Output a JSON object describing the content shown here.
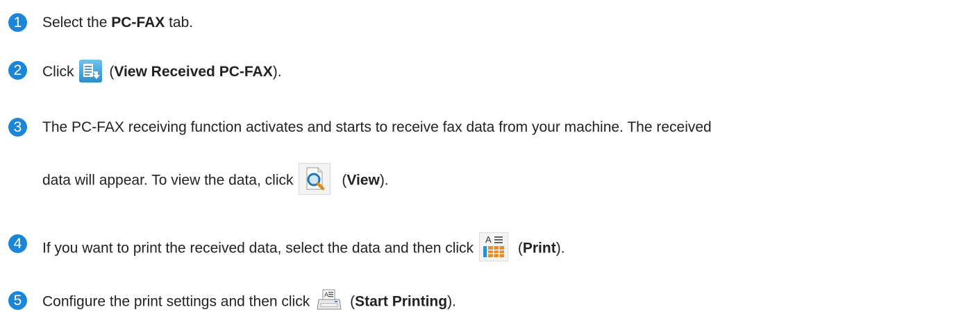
{
  "steps": [
    {
      "number": "1",
      "before": "Select the ",
      "bold": "PC-FAX",
      "after": " tab."
    },
    {
      "number": "2",
      "before": "Click ",
      "icon": "view-received-pcfax-icon",
      "paren_open": "(",
      "bold": "View Received PC-FAX",
      "after": ")."
    },
    {
      "number": "3",
      "line1": "The PC-FAX receiving function activates and starts to receive fax data from your machine. The received",
      "before": "data will appear. To view the data, click ",
      "icon": "view-magnifier-icon",
      "paren_open": "(",
      "bold": "View",
      "after": ")."
    },
    {
      "number": "4",
      "before": "If you want to print the received data, select the data and then click ",
      "icon": "print-icon",
      "paren_open": "(",
      "bold": "Print",
      "after": ")."
    },
    {
      "number": "5",
      "before": "Configure the print settings and then click ",
      "icon": "start-printing-icon",
      "paren_open": "(",
      "bold": "Start Printing",
      "after": ")."
    }
  ],
  "colors": {
    "step_badge": "#1b86d8",
    "text": "#222222"
  }
}
